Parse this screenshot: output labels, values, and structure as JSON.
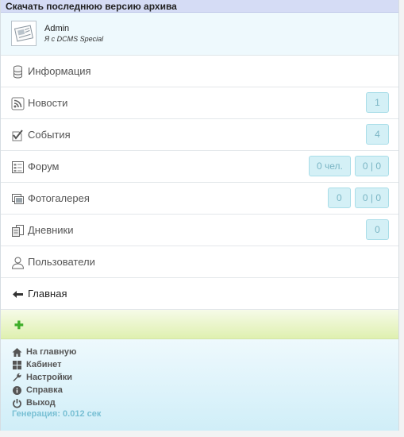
{
  "topbar": {
    "title": "Скачать последнюю версию архива"
  },
  "user": {
    "name": "Admin",
    "status": "Я с DCMS Special"
  },
  "menu": [
    {
      "label": "Информация",
      "icon": "database-icon",
      "badges": []
    },
    {
      "label": "Новости",
      "icon": "rss-icon",
      "badges": [
        "1"
      ]
    },
    {
      "label": "События",
      "icon": "checkmark-icon",
      "badges": [
        "4"
      ]
    },
    {
      "label": "Форум",
      "icon": "forum-icon",
      "badges": [
        "0 чел.",
        "0 | 0"
      ]
    },
    {
      "label": "Фотогалерея",
      "icon": "photos-icon",
      "badges": [
        "0",
        "0 | 0"
      ]
    },
    {
      "label": "Дневники",
      "icon": "diary-icon",
      "badges": [
        "0"
      ]
    },
    {
      "label": "Пользователи",
      "icon": "user-icon",
      "badges": []
    },
    {
      "label": "Главная",
      "icon": "arrow-left-icon",
      "badges": []
    }
  ],
  "green_bar": {
    "icon": "plus-icon"
  },
  "footer": {
    "links": [
      {
        "label": "На главную",
        "icon": "home-icon"
      },
      {
        "label": "Кабинет",
        "icon": "grid-icon"
      },
      {
        "label": "Настройки",
        "icon": "wrench-icon"
      },
      {
        "label": "Справка",
        "icon": "info-icon"
      },
      {
        "label": "Выход",
        "icon": "power-icon"
      }
    ],
    "generation": "Генерация: 0.012 сек"
  }
}
